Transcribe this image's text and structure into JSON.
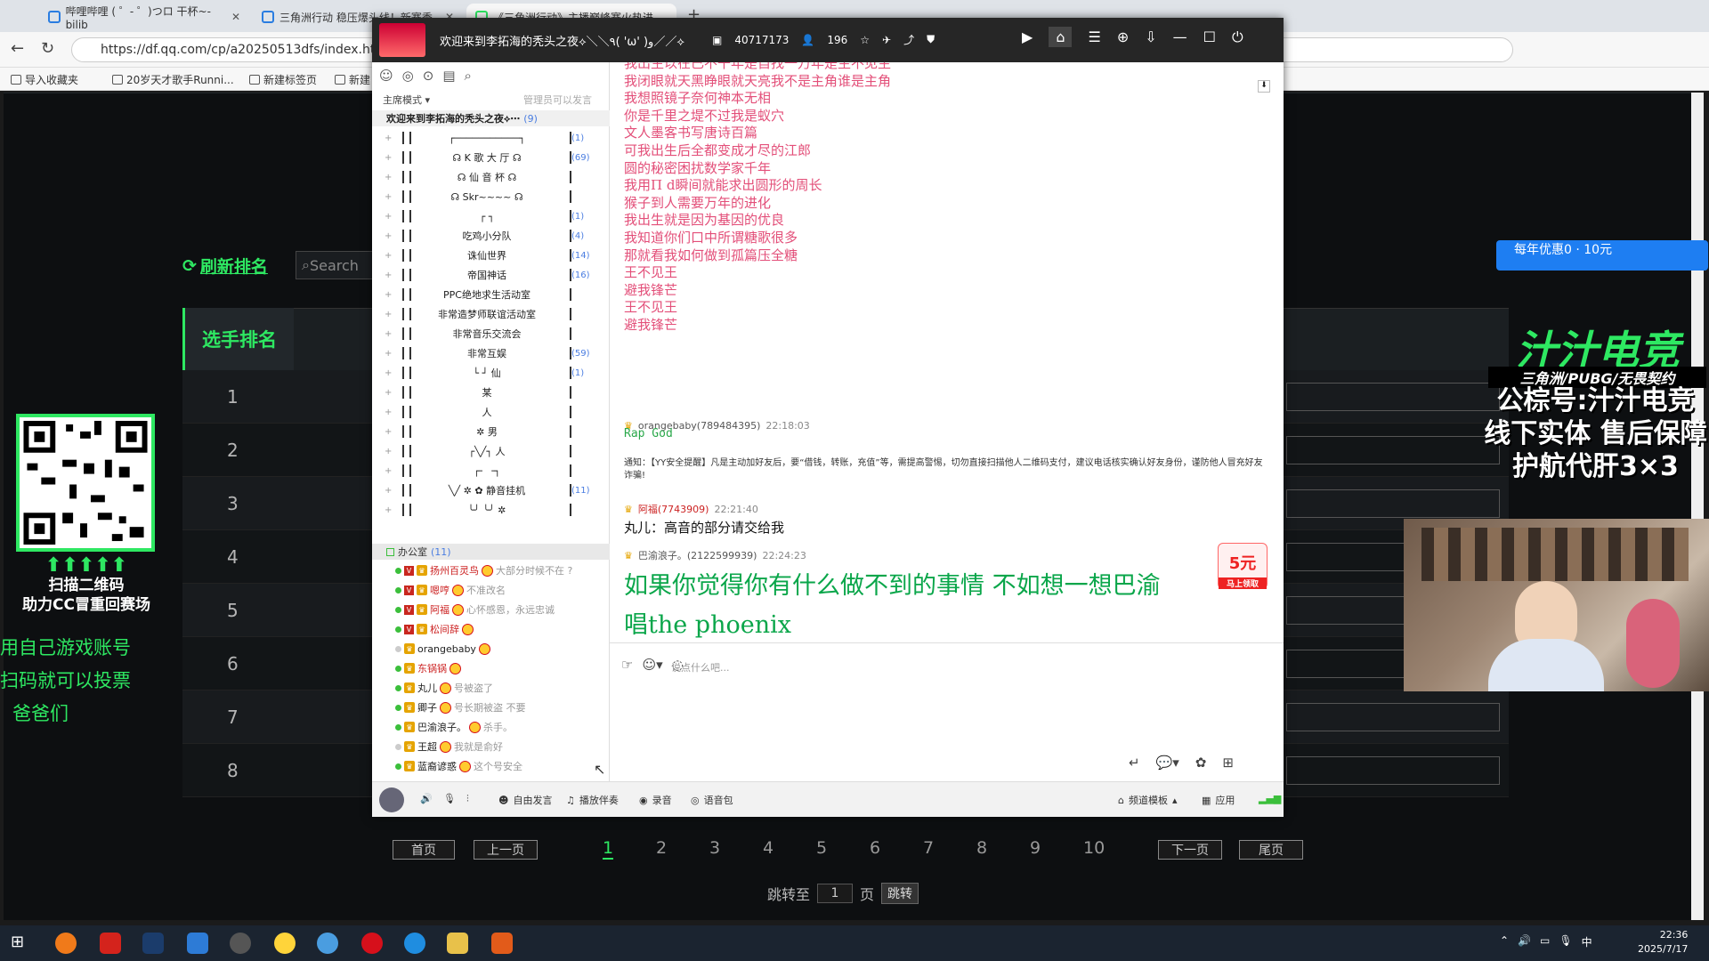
{
  "browser": {
    "tabs": [
      {
        "label": "哔哩哔哩 ( ゜- ゜)つロ 干杯~-bilib"
      },
      {
        "label": "三角洲行动 稳压爆头线！新赛季"
      },
      {
        "label": "《三角洲行动》主播巅峰赛火热进"
      }
    ],
    "url": "https://df.qq.com/cp/a20250513dfs/index.html?",
    "bookmarks": [
      "导入收藏夹",
      "20岁天才歌手Runni...",
      "新建标签页",
      "新建"
    ]
  },
  "page": {
    "refresh_label": "刷新排名",
    "search_placeholder": "Search",
    "rank_title": "选手排名",
    "ranks": [
      "1",
      "2",
      "3",
      "4",
      "5",
      "6",
      "7",
      "8"
    ],
    "left_ad": {
      "scan": "⬆⬆⬆⬆⬆",
      "scan_line1": "扫描二维码",
      "scan_line2": "助力CC冒重回赛场",
      "lines": [
        "用自己游戏账号",
        "扫码就可以投票",
        "爸爸们"
      ]
    },
    "right_ad": {
      "banner": "每年优惠0 · 10元",
      "brand": "汁汁电竞",
      "sub": "三角洲/PUBG/无畏契约",
      "lines": [
        "公棕号:汁汁电竞",
        "线下实体 售后保障",
        "护航代肝3×3"
      ]
    },
    "pagination": {
      "first": "首页",
      "prev": "上一页",
      "pages": [
        "1",
        "2",
        "3",
        "4",
        "5",
        "6",
        "7",
        "8",
        "9",
        "10"
      ],
      "next": "下一页",
      "last": "尾页",
      "jump_prefix": "跳转至",
      "jump_value": "1",
      "jump_suffix": "页",
      "jump_btn": "跳转"
    }
  },
  "yy": {
    "channel_name": "欢迎来到李拓海的秃头之夜⟡＼＼٩( 'ω' )و／／⟡",
    "online_count": "40717173",
    "member_count": "196",
    "mode": "主席模式",
    "admin_note": "管理员可以发言",
    "root_channel": "欢迎来到李拓海的秃头之夜⟡⋯",
    "root_count": "(9)",
    "channels": [
      {
        "name": "┌───────────┐",
        "count": "(1)"
      },
      {
        "name": "☊ K 歌 大 厅 ☊",
        "count": "(69)"
      },
      {
        "name": "☊  仙 音 杯  ☊",
        "count": ""
      },
      {
        "name": "☊  Skr~~~~   ☊",
        "count": ""
      },
      {
        "name": "┌     ┐",
        "count": "(1)"
      },
      {
        "name": "吃鸡小分队",
        "count": "(4)"
      },
      {
        "name": "诛仙世界",
        "count": "(14)"
      },
      {
        "name": "帝国神话",
        "count": "(16)"
      },
      {
        "name": "PPC绝地求生活动室",
        "count": ""
      },
      {
        "name": "非常造梦师联谊活动室",
        "count": ""
      },
      {
        "name": "非常音乐交流会",
        "count": ""
      },
      {
        "name": "非常互娱",
        "count": "(59)"
      },
      {
        "name": "└     ┘    仙",
        "count": "(1)"
      },
      {
        "name": "某",
        "count": ""
      },
      {
        "name": "人",
        "count": ""
      },
      {
        "name": "✲          男",
        "count": ""
      },
      {
        "name": "┌╲╱┐       人",
        "count": ""
      },
      {
        "name": "┌╴  ╶┐",
        "count": ""
      },
      {
        "name": "╲╱ ✲ ✿  静音挂机",
        "count": "(11)"
      },
      {
        "name": "╰╯ ╰╯  ✲",
        "count": ""
      }
    ],
    "office": {
      "name": "办公室",
      "count": "(11)"
    },
    "users": [
      {
        "name": "扬州百灵鸟",
        "sig": "大部分时候不在 ?"
      },
      {
        "name": "嗯哼",
        "sig": "不准改名"
      },
      {
        "name": "阿福",
        "sig": "心怀感恩，永远忠诚"
      },
      {
        "name": "松间辞",
        "sig": ""
      },
      {
        "name": "orangebaby",
        "sig": ""
      },
      {
        "name": "东锅锅",
        "sig": ""
      },
      {
        "name": "丸儿",
        "sig": "号被盗了"
      },
      {
        "name": "卿子",
        "sig": "号长期被盗 不要"
      },
      {
        "name": "巴渝浪子。",
        "sig": "杀手。"
      },
      {
        "name": "王超",
        "sig": "我就是俞好"
      },
      {
        "name": "蓝裔谚惑",
        "sig": "这个号安全"
      }
    ],
    "lyrics": [
      "我出生以在已不干年是自找一万年是主不见主",
      "我闭眼就天黑睁眼就天亮我不是主角谁是主角",
      "我想照镜子奈何神本无相",
      "你是千里之堤不过我是蚁穴",
      "文人墨客书写唐诗百篇",
      "可我出生后全都变成才尽的江郎",
      "圆的秘密困扰数学家千年",
      "我用Π d瞬间就能求出圆形的周长",
      "猴子到人需要万年的进化",
      "我出生就是因为基因的优良",
      "我知道你们口中所谓糖歌很多",
      "那就看我如何做到孤篇压全糖",
      "王不见王",
      "避我锋芒",
      "王不见王",
      "避我锋芒"
    ],
    "msg1": {
      "user": "orangebaby(789484395)",
      "time": "22:18:03",
      "text": "Rap God"
    },
    "notice": "通知：【YY安全提醒】凡是主动加好友后，要“借钱，转账，充值”等，需提高警惕，切勿直接扫描他人二维码支付，建议电话核实确认好友身份，谨防他人冒充好友诈骗!",
    "msg2": {
      "user": "阿福(7743909)",
      "time": "22:21:40",
      "text": "丸儿：高音的部分请交给我"
    },
    "msg3": {
      "user": "巴渝浪子。(2122599939)",
      "time": "22:24:23",
      "text1": "如果你觉得你有什么做不到的事情 不如想一想巴渝",
      "text2": "唱the phoenix"
    },
    "promo": {
      "amount": "5元",
      "label": "马上领取"
    },
    "input_placeholder": "说点什么吧...",
    "bottom": {
      "free": "自由发言",
      "accomp": "播放伴奏",
      "record": "录音",
      "voice": "语音包",
      "template": "频道模板",
      "apps": "应用"
    }
  },
  "taskbar": {
    "time": "22:36",
    "date": "2025/7/17",
    "ime": "中"
  }
}
